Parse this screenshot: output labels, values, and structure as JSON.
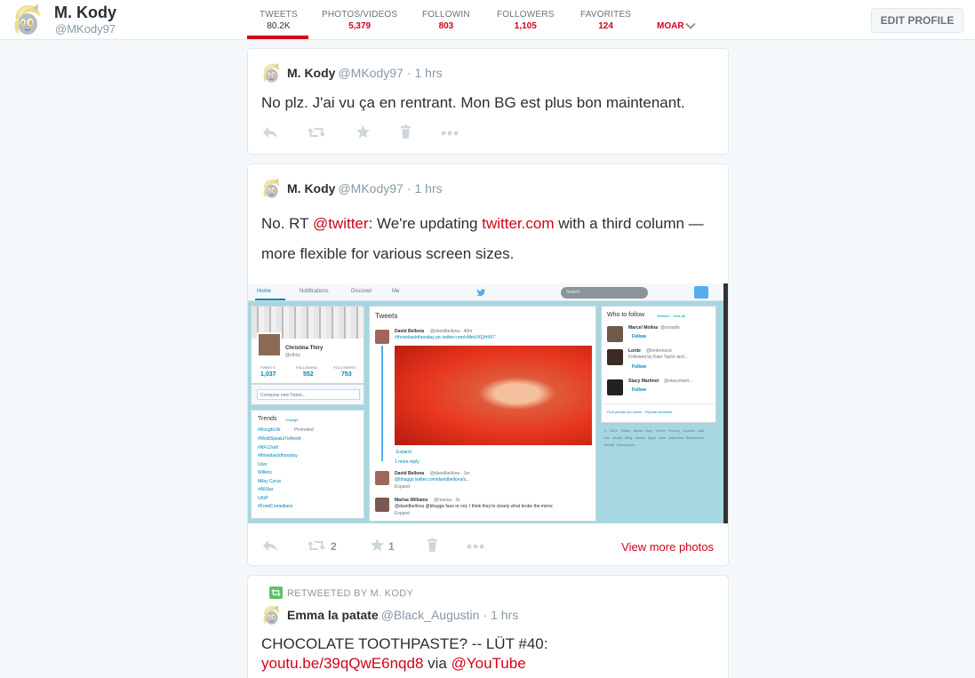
{
  "profile": {
    "name": "M. Kody",
    "handle": "@MKody97"
  },
  "stats": [
    {
      "label": "TWEETS",
      "value": "80.2K",
      "active": true
    },
    {
      "label": "PHOTOS/VIDEOS",
      "value": "5,379"
    },
    {
      "label": "FOLLOWIN",
      "value": "803"
    },
    {
      "label": "FOLLOWERS",
      "value": "1,105"
    },
    {
      "label": "FAVORITES",
      "value": "124"
    }
  ],
  "moar_label": "MOAR",
  "edit_profile_label": "EDIT PROFILE",
  "tweets": [
    {
      "name": "M. Kody",
      "handle": "@MKody97",
      "sep": "·",
      "time": "1 hrs",
      "text": "No plz. J'ai vu ça en rentrant. Mon BG est plus bon maintenant."
    },
    {
      "name": "M. Kody",
      "handle": "@MKody97",
      "sep": "·",
      "time": "1 hrs",
      "text_a": "No. RT ",
      "mention": "@twitter",
      "text_b": ": We're updating ",
      "link": "twitter.com",
      "text_c": " with a third column — more flexible for various screen sizes.",
      "retweet_count": "2",
      "favorite_count": "1",
      "view_more": "View more photos"
    },
    {
      "retweeted_by": "RETWEETED BY M. KODY",
      "name": "Emma la patate",
      "handle": "@Black_Augustin",
      "sep": "·",
      "time": "1 hrs",
      "text_a": "CHOCOLATE TOOTHPASTE? -- LÜT #40:",
      "link": "youtu.be/39qQwE6nqd8",
      "text_b": " via ",
      "mention": "@YouTube"
    }
  ],
  "photo": {
    "nav": [
      "Home",
      "Notifications",
      "Discover",
      "Me"
    ],
    "search_placeholder": "Search",
    "profile_name": "Christina Thiry",
    "profile_handle": "@cthiry",
    "profile_stats": [
      {
        "label": "TWEETS",
        "value": "1,037"
      },
      {
        "label": "FOLLOWING",
        "value": "552"
      },
      {
        "label": "FOLLOWERS",
        "value": "753"
      }
    ],
    "compose_placeholder": "Compose new Tweet...",
    "trends_title": "Trends",
    "trends_change": "· Change",
    "trends": [
      "#RoughLife",
      "#ModiSpeaksToAmeb",
      "#NFLDraft",
      "#throwbackthursday",
      "User",
      "Wilkins",
      "Miley Cyrus",
      "#AllStar",
      "UKIP",
      "#FoodComedians"
    ],
    "trends_promoted": "Promoted",
    "tweets_title": "Tweets",
    "feed": [
      {
        "name": "David Bellona",
        "handle": "@davidbellona · 40m",
        "text": "#throwbackthursday pic.twitter.com/vMmVXQH4X7"
      },
      {
        "name": "David Bellona",
        "handle": "@davidbellona · 1m",
        "text": "@bhaggs twitter.com/davidbellona/s..."
      },
      {
        "name": "Marisa Williams",
        "handle": "@marisa · 3s",
        "text": "@davidbellona @bhaggs faux or not, I think they're clearly what broke the mirror."
      }
    ],
    "expand": "Expand",
    "more_reply": "1 more reply",
    "wtf_title": "Who to follow",
    "wtf_links": "· Refresh · View all",
    "wtf": [
      {
        "name": "Marcel Molina",
        "handle": "@noradio",
        "sub": ""
      },
      {
        "name": "Lorde",
        "handle": "@lordemusic",
        "sub": "Followed by Kate Taylor and..."
      },
      {
        "name": "Stacy Martinet",
        "handle": "@stacymarti...",
        "sub": ""
      }
    ],
    "follow_label": "Follow",
    "find_people": "Find people you know · Popular accounts",
    "footer": "© 2014 Twitter  About  Help  Terms  Privacy  Cookies  Ads info  Brand  Blog  Status  Apps  Jobs  Advertise  Businesses  Media  Developers"
  },
  "colors": {
    "accent": "#d0021b",
    "muted": "#8899a6",
    "text": "#292f33",
    "background": "#f5f8fa",
    "photo_bg": "#a6d7e0",
    "photo_link": "#0084b4"
  },
  "icons": [
    "avatar-pony-icon",
    "reply-icon",
    "retweet-icon",
    "favorite-icon",
    "delete-icon",
    "more-icon",
    "chevron-down-icon",
    "twitter-bird-icon"
  ]
}
